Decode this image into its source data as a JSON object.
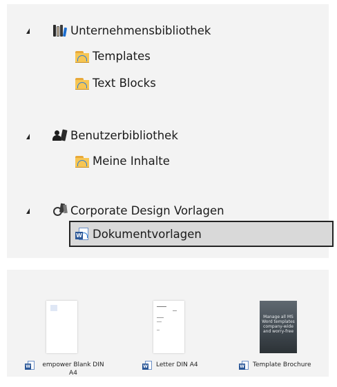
{
  "tree": {
    "groups": [
      {
        "label": "Unternehmensbibliothek",
        "icon": "library-books-icon",
        "children": [
          {
            "label": "Templates",
            "icon": "cloud-folder-icon"
          },
          {
            "label": "Text Blocks",
            "icon": "cloud-folder-icon"
          }
        ]
      },
      {
        "label": "Benutzerbibliothek",
        "icon": "user-library-icon",
        "children": [
          {
            "label": "Meine Inhalte",
            "icon": "cloud-folder-icon"
          }
        ]
      },
      {
        "label": "Corporate Design Vorlagen",
        "icon": "corporate-design-icon",
        "children": [
          {
            "label": "Dokumentvorlagen",
            "icon": "word-cloud-icon",
            "selected": true
          }
        ]
      }
    ]
  },
  "gallery": {
    "items": [
      {
        "caption": "empower Blank DIN A4",
        "icon": "word-file-icon"
      },
      {
        "caption": "Letter DIN A4",
        "icon": "word-file-icon"
      },
      {
        "caption": "Template Brochure",
        "icon": "word-file-icon",
        "thumb_text": "Manage all MS Word templates company-wide and worry-free"
      }
    ]
  },
  "colors": {
    "panel_bg": "#f3f3f3",
    "selection_bg": "#d9d9d9",
    "folder": "#f7c653",
    "word_blue": "#2b5797"
  }
}
